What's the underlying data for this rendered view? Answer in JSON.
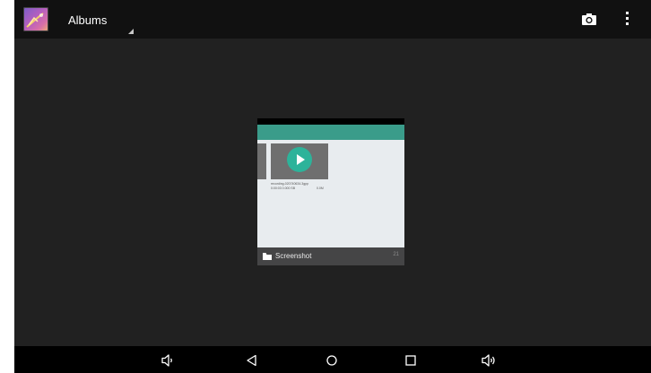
{
  "action_bar": {
    "title": "Albums",
    "app_icon": "gallery-app-icon",
    "camera_icon": "camera-icon",
    "overflow_icon": "overflow-menu-icon"
  },
  "albums": [
    {
      "name": "Screenshot",
      "count": "21",
      "folder_icon": "folder-icon",
      "thumbnail": {
        "captions": [
          "recording-020740634.3gpp",
          "0:00:03 0.000 SB",
          "0.0M"
        ]
      }
    }
  ],
  "nav_bar": {
    "buttons": [
      "volume-down-icon",
      "back-icon",
      "home-icon",
      "recents-icon",
      "volume-up-icon"
    ]
  },
  "colors": {
    "background": "#212121",
    "action_bar": "#111111",
    "nav_bar": "#000000",
    "accent": "#3a9c8a",
    "play": "#2db39a"
  }
}
